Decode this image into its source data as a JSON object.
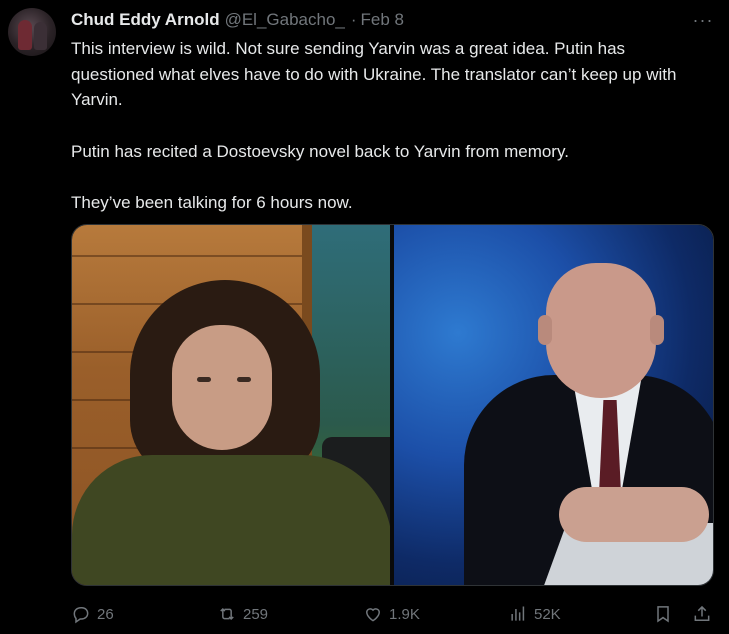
{
  "author": {
    "display_name": "Chud Eddy Arnold",
    "handle": "@El_Gabacho_",
    "separator": "·",
    "date": "Feb 8"
  },
  "menu": {
    "more_label": "···"
  },
  "tweet": {
    "paragraphs": [
      "This interview is wild. Not sure sending Yarvin was a great idea. Putin has questioned what elves have to do with Ukraine. The translator can’t keep up with Yarvin.",
      "Putin has recited a Dostoevsky novel back to Yarvin from memory.",
      "They’ve been talking for 6 hours now."
    ]
  },
  "actions": {
    "reply_count": "26",
    "retweet_count": "259",
    "like_count": "1.9K",
    "views_count": "52K"
  },
  "colors": {
    "background": "#000000",
    "text": "#e7e9ea",
    "muted": "#71767b"
  },
  "icons": [
    "reply-icon",
    "retweet-icon",
    "like-icon",
    "views-icon",
    "bookmark-icon",
    "share-icon",
    "more-icon"
  ]
}
